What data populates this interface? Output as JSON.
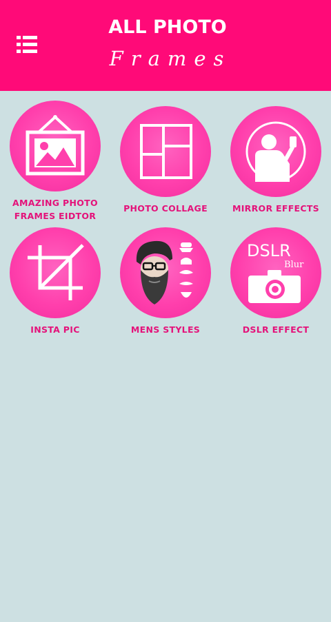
{
  "header": {
    "title_line1": "ALL PHOTO",
    "title_line2": "Frames",
    "menu_icon": "menu-list-icon"
  },
  "tiles": [
    {
      "label": "AMAZING PHOTO FRAMES EIDTOR",
      "icon": "photo-frame-icon"
    },
    {
      "label": "PHOTO COLLAGE",
      "icon": "collage-grid-icon"
    },
    {
      "label": "MIRROR EFFECTS",
      "icon": "mirror-selfie-icon"
    },
    {
      "label": "INSTA PIC",
      "icon": "crop-icon"
    },
    {
      "label": "MENS STYLES",
      "icon": "beard-man-icon"
    },
    {
      "label": "DSLR EFFECT",
      "icon": "dslr-camera-icon",
      "icon_text": "DSLR",
      "icon_subtext": "Blur"
    }
  ],
  "colors": {
    "header_bg": "#ff0a78",
    "page_bg": "#cde0e2",
    "circle": "#ff3fac",
    "label": "#e4127a"
  }
}
